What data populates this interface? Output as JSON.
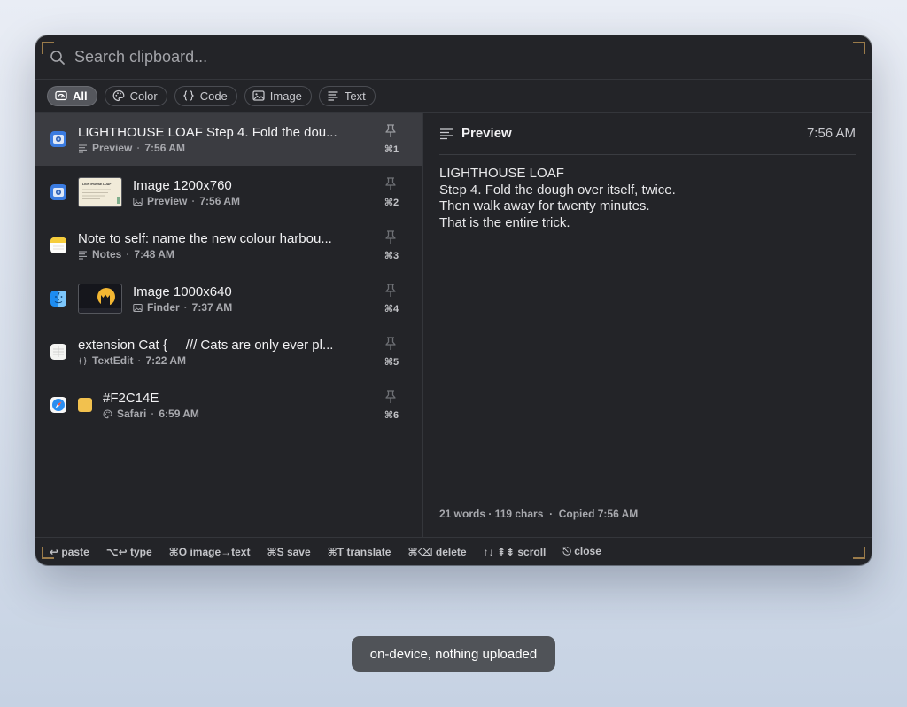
{
  "search": {
    "placeholder": "Search clipboard..."
  },
  "filters": [
    {
      "label": "All",
      "icon": "all-icon",
      "active": true
    },
    {
      "label": "Color",
      "icon": "palette-icon",
      "active": false
    },
    {
      "label": "Code",
      "icon": "braces-icon",
      "active": false
    },
    {
      "label": "Image",
      "icon": "image-icon",
      "active": false
    },
    {
      "label": "Text",
      "icon": "text-lines-icon",
      "active": false
    }
  ],
  "items": [
    {
      "title": "LIGHTHOUSE LOAF Step 4. Fold the dou...",
      "type_icon": "text-lines-icon",
      "app": "Preview",
      "time": "7:56 AM",
      "shortcut": "⌘1",
      "app_icon": "preview-app-icon",
      "selected": true
    },
    {
      "title": "Image 1200x760",
      "type_icon": "image-icon",
      "app": "Preview",
      "time": "7:56 AM",
      "shortcut": "⌘2",
      "app_icon": "preview-app-icon",
      "thumbnail": {
        "heading": "LIGHTHOUSE LOAF"
      }
    },
    {
      "title": "Note to self: name the new colour harbou...",
      "type_icon": "text-lines-icon",
      "app": "Notes",
      "time": "7:48 AM",
      "shortcut": "⌘3",
      "app_icon": "notes-app-icon"
    },
    {
      "title": "Image 1000x640",
      "type_icon": "image-icon",
      "app": "Finder",
      "time": "7:37 AM",
      "shortcut": "⌘4",
      "app_icon": "finder-app-icon"
    },
    {
      "title": "extension Cat {     /// Cats are only ever pl...",
      "type_icon": "braces-icon",
      "app": "TextEdit",
      "time": "7:22 AM",
      "shortcut": "⌘5",
      "app_icon": "textedit-app-icon"
    },
    {
      "title": "#F2C14E",
      "type_icon": "palette-icon",
      "app": "Safari",
      "time": "6:59 AM",
      "shortcut": "⌘6",
      "app_icon": "safari-app-icon",
      "swatch": "#F2C14E"
    }
  ],
  "preview": {
    "title": "Preview",
    "time": "7:56 AM",
    "lines": [
      "LIGHTHOUSE LOAF",
      "Step 4. Fold the dough over itself, twice.",
      "Then walk away for twenty minutes.",
      "That is the entire trick."
    ],
    "stats": "21 words · 119 chars  ·  Copied 7:56 AM"
  },
  "footer": [
    "↩ paste",
    "⌥↩ type",
    "⌘O image→text",
    "⌘S save",
    "⌘T translate",
    "⌘⌫ delete",
    "↑↓ ⇞⇟ scroll",
    "⎋ close"
  ],
  "toast": "on-device, nothing uploaded",
  "colors": {
    "window_bg": "#232428",
    "selected_row": "#3b3c41",
    "corner_accent": "#9a7b4a",
    "swatch": "#F2C14E"
  }
}
